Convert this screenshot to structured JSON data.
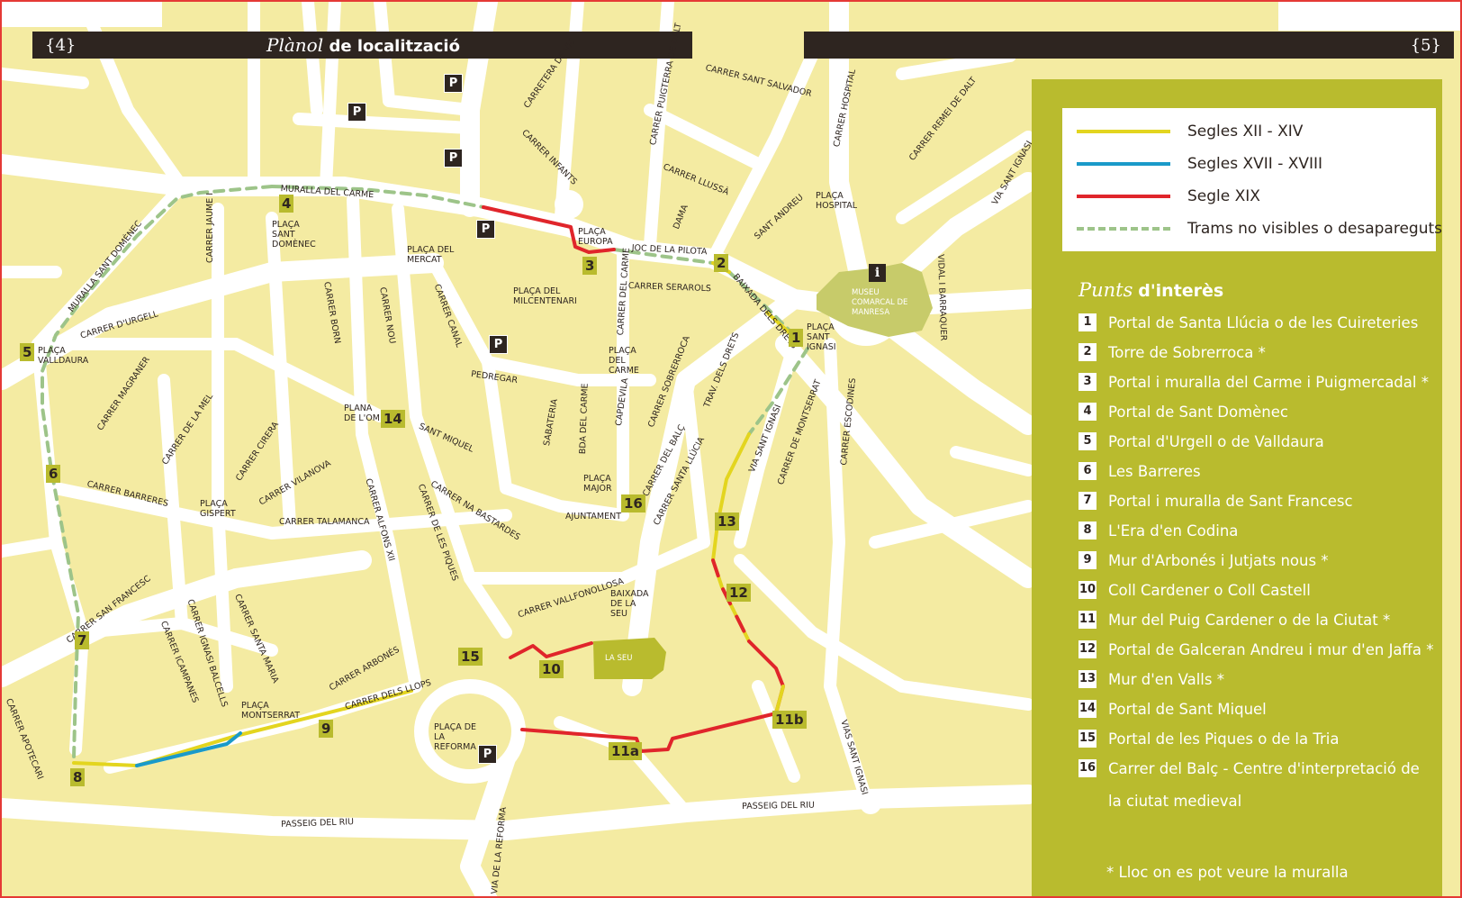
{
  "header": {
    "left_page": "{4}",
    "right_page": "{5}",
    "title_italic": "Plànol",
    "title_bold": "de localització"
  },
  "legend": {
    "items": [
      {
        "label": "Segles XII - XIV",
        "color": "#e3d51f",
        "style": "solid"
      },
      {
        "label": "Segles XVII - XVIII",
        "color": "#1a9ac9",
        "style": "solid"
      },
      {
        "label": "Segle XIX",
        "color": "#e0252b",
        "style": "solid"
      },
      {
        "label": "Trams no visibles o desapareguts",
        "color": "#9dc489",
        "style": "dashed"
      }
    ]
  },
  "points": {
    "title_italic": "Punts",
    "title_bold": "d'interès",
    "items": [
      {
        "num": "1",
        "label": "Portal de Santa Llúcia o de les Cuireteries"
      },
      {
        "num": "2",
        "label": "Torre de Sobrerroca *"
      },
      {
        "num": "3",
        "label": "Portal i muralla del Carme i  Puigmercadal *"
      },
      {
        "num": "4",
        "label": "Portal de Sant Domènec"
      },
      {
        "num": "5",
        "label": "Portal d'Urgell o de Valldaura"
      },
      {
        "num": "6",
        "label": "Les Barreres"
      },
      {
        "num": "7",
        "label": "Portal i muralla de Sant Francesc"
      },
      {
        "num": "8",
        "label": "L'Era d'en Codina"
      },
      {
        "num": "9",
        "label": "Mur d'Arbonés  i Jutjats nous *"
      },
      {
        "num": "10",
        "label": "Coll Cardener o Coll Castell"
      },
      {
        "num": "11",
        "label": "Mur del Puig Cardener o de la Ciutat *"
      },
      {
        "num": "12",
        "label": "Portal de Galceran Andreu i mur d'en Jaffa *"
      },
      {
        "num": "13",
        "label": "Mur d'en Valls *"
      },
      {
        "num": "14",
        "label": "Portal de Sant Miquel"
      },
      {
        "num": "15",
        "label": "Portal de les Piques o de la Tria"
      },
      {
        "num": "16",
        "label": "Carrer del Balç - Centre d'interpretació de la ciutat medieval"
      }
    ],
    "note": "*  Lloc on es pot veure la muralla"
  },
  "map": {
    "colors": {
      "ground": "#f4eba2",
      "street": "#ffffff",
      "building": "#c7cb6a",
      "marker": "#b9bb2e",
      "dark": "#2e2520"
    },
    "markers": [
      "1",
      "2",
      "3",
      "4",
      "5",
      "6",
      "7",
      "8",
      "9",
      "10",
      "11a",
      "11b",
      "12",
      "13",
      "14",
      "15",
      "16"
    ],
    "parking_label": "P",
    "info_label": "i",
    "buildings": {
      "museum": "MUSEU COMARCAL DE MANRESA",
      "seu": "LA SEU"
    },
    "street_labels": [
      "CARRER SANT SALVADOR",
      "CARRER INFANTS",
      "CARRETERA DE VIC",
      "CARRER PUIGTERRA DE DALT",
      "CARRER HOSPITAL",
      "CARRER REMEI DE DALT",
      "VIA SANT IGNASI",
      "CARRER LLUSSÀ",
      "DAMA",
      "SANT ANDREU",
      "PLAÇA HOSPITAL",
      "MURALLA DEL CARME",
      "PLAÇA SANT DOMÈNEC",
      "CARRER JAUME I",
      "MURALLA SANT DOMÈNEC",
      "PLAÇA DEL MERCAT",
      "PLAÇA EUROPA",
      "JOC DE LA PILOTA",
      "CARRER SERAROLS",
      "BAIXADA DELS DRETS",
      "VIDAL I BARRAQUER",
      "PLAÇA SANT IGNASI",
      "PLAÇA DEL MILCENTENARI",
      "CARRER DEL CARME",
      "CARRER D'URGELL",
      "CARRER BORN",
      "CARRER NOU",
      "CARRER CANAL",
      "PLAÇA VALLDAURA",
      "PLAÇA DEL CARME",
      "PEDREGAR",
      "CARRER SOBRERROCA",
      "TRAV. DELS DRETS",
      "CARRER MAGRANER",
      "PLANA DE L'OM",
      "SANT MIQUEL",
      "CAPDEVILA",
      "BDA DEL CARME",
      "SABATERIA",
      "CARRER DE LA MEL",
      "CARRER CIRERA",
      "VIA SANT IGNASI",
      "CARRER DE MONTSERRAT",
      "CARRER ESCODINES",
      "CARRER BARRERES",
      "CARRER VILANOVA",
      "PLAÇA MAJOR",
      "CARRER DEL BALÇ",
      "CARRER SANTA LLÚCIA",
      "PLAÇA GISPERT",
      "CARRER TALAMANCA",
      "CARRER NA BASTARDES",
      "AJUNTAMENT",
      "CARRER ALFONS XII",
      "CARRER DE LES PIQUES",
      "CARRER VALLFONOLLOSA",
      "BAIXADA DE LA SEU",
      "CARRER SAN FRANCESC",
      "CARRER IGNASI BALCELLS",
      "CARRER SANTA MARIA",
      "CARRER ICAMPANES",
      "CARRER ARBONÉS",
      "CARRER DELS LLOPS",
      "PLAÇA MONTSERRAT",
      "CARRER APOTECARI",
      "PLAÇA DE LA REFORMA",
      "PASSEIG DEL RIU",
      "PASSEIG DEL RIU",
      "VIA DE LA REFORMA",
      "VIAS SANT IGNASI"
    ]
  }
}
